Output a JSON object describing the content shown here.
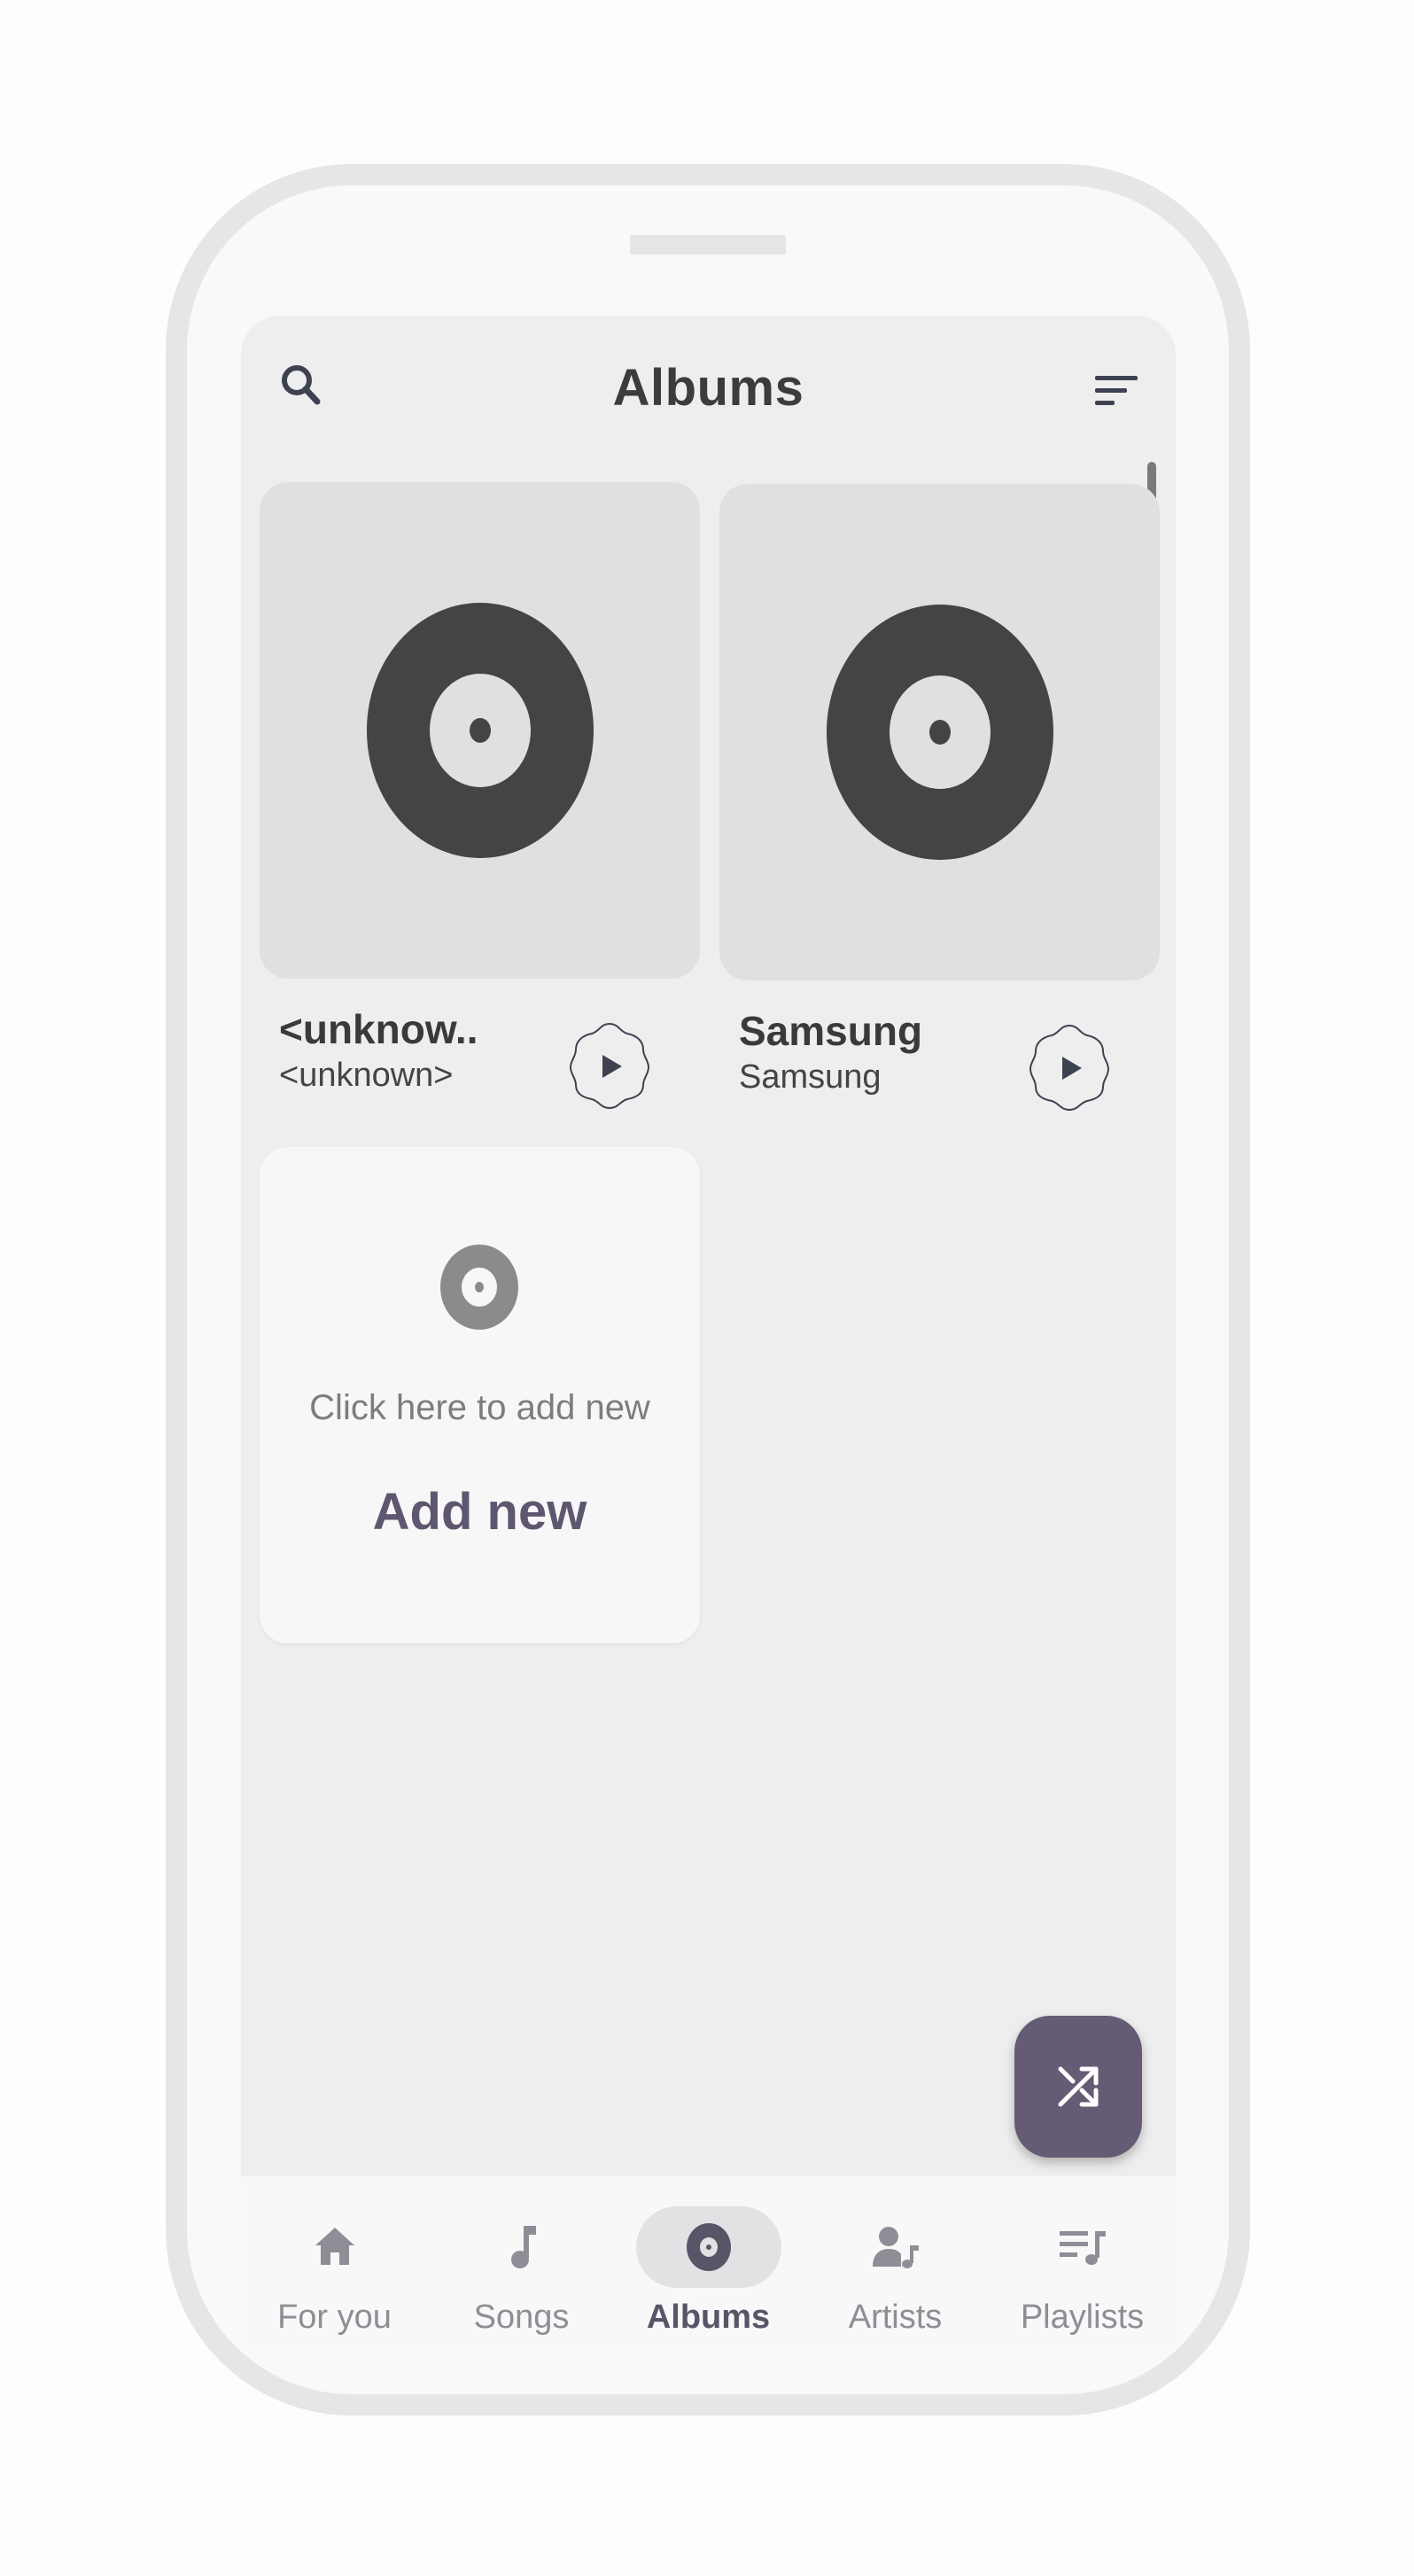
{
  "header": {
    "title": "Albums",
    "search_icon": "search-icon",
    "sort_icon": "sort-icon"
  },
  "albums": [
    {
      "title": "<unknow..",
      "artist": "<unknown>",
      "art_icon": "vinyl-disc-icon",
      "play_icon": "play-icon"
    },
    {
      "title": "Samsung",
      "artist": "Samsung",
      "art_icon": "vinyl-disc-icon",
      "play_icon": "play-icon"
    }
  ],
  "add_card": {
    "hint": "Click here to add new",
    "label": "Add new",
    "icon": "disc-icon"
  },
  "fab": {
    "icon": "shuffle-icon"
  },
  "nav": {
    "items": [
      {
        "label": "For you",
        "icon": "home-icon",
        "active": false
      },
      {
        "label": "Songs",
        "icon": "music-note-icon",
        "active": false
      },
      {
        "label": "Albums",
        "icon": "album-icon",
        "active": true
      },
      {
        "label": "Artists",
        "icon": "artist-icon",
        "active": false
      },
      {
        "label": "Playlists",
        "icon": "playlist-icon",
        "active": false
      }
    ]
  },
  "colors": {
    "accent": "#655b75",
    "screen_bg": "#eeeeee",
    "card_bg": "#e0e0e0",
    "disc": "#444444"
  }
}
